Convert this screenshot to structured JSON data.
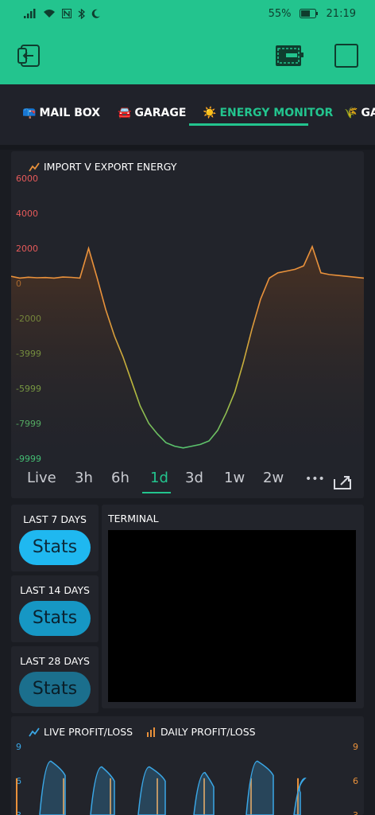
{
  "status_bar": {
    "battery": "55%",
    "time": "21:19",
    "icons": [
      "signal-icon",
      "wifi-icon",
      "nfc-icon",
      "bluetooth-icon",
      "moon-icon",
      "battery-icon"
    ]
  },
  "app_bar": {
    "left_icon": "exit-app-icon",
    "right_icons": [
      "device-icon",
      "square-icon"
    ]
  },
  "tabs": [
    {
      "emoji": "📪",
      "label": "MAIL BOX"
    },
    {
      "emoji": "🚘",
      "label": "GARAGE"
    },
    {
      "emoji": "☀️",
      "label": "ENERGY MONITOR",
      "active": true
    },
    {
      "emoji": "🌾",
      "label": "GA"
    }
  ],
  "energy_chart": {
    "title": "IMPORT V EXPORT ENERGY",
    "chart_data": {
      "type": "area",
      "title": "IMPORT V EXPORT ENERGY",
      "y_ticks": [
        "6000",
        "4000",
        "2000",
        "0",
        "-2000",
        "-3999",
        "-5999",
        "-7999",
        "-9999"
      ],
      "ylim": [
        -9999,
        6000
      ],
      "series": [
        {
          "values": [
            400,
            300,
            350,
            320,
            330,
            300,
            360,
            340,
            300,
            2000,
            300,
            -1500,
            -3000,
            -4200,
            -5600,
            -7000,
            -8000,
            -8600,
            -9100,
            -9300,
            -9400,
            -9300,
            -9200,
            -9000,
            -8400,
            -7400,
            -6200,
            -4500,
            -2600,
            -900,
            300,
            600,
            700,
            800,
            1000,
            2100,
            600,
            500,
            450,
            400,
            350,
            300
          ]
        }
      ]
    }
  },
  "time_ranges": [
    "Live",
    "3h",
    "6h",
    "1d",
    "3d",
    "1w",
    "2w",
    "•••"
  ],
  "active_range": "1d",
  "stats": [
    {
      "label": "LAST 7 DAYS",
      "button": "Stats",
      "color": "#1fb8f0",
      "text_color": "#0c2a3a"
    },
    {
      "label": "LAST 14 DAYS",
      "button": "Stats",
      "color": "#1697c4",
      "text_color": "#0a2230"
    },
    {
      "label": "LAST 28 DAYS",
      "button": "Stats",
      "color": "#1b6f8d",
      "text_color": "#0a1e28"
    }
  ],
  "terminal": {
    "title": "TERMINAL"
  },
  "profit_chart": {
    "title_live": "LIVE PROFIT/LOSS",
    "title_daily": "DAILY PROFIT/LOSS",
    "chart_data": {
      "type": "area",
      "y_ticks_left": [
        "9",
        "6",
        "3"
      ],
      "y_ticks_right": [
        "9",
        "6",
        "3"
      ],
      "series": [
        {
          "name": "LIVE PROFIT/LOSS",
          "values": [
            0,
            7,
            0,
            6,
            0,
            6,
            0,
            5,
            0,
            7,
            0,
            4,
            0
          ]
        },
        {
          "name": "DAILY PROFIT/LOSS",
          "values": [
            4,
            4,
            4,
            4,
            4,
            4,
            4
          ]
        }
      ]
    }
  },
  "colors": {
    "brand": "#23c48e",
    "chart_orange": "#e9913b",
    "chart_green": "#45c577",
    "profit_blue": "#3aa7e6"
  }
}
